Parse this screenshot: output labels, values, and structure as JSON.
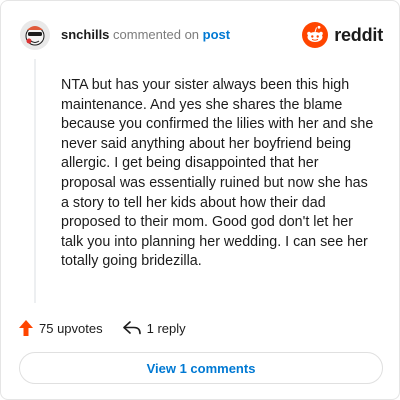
{
  "comment": {
    "username": "snchills",
    "action_text": "commented on",
    "post_link": "post",
    "body": "NTA but has your sister always been this high maintenance. And yes she shares the blame because you confirmed the lilies with her and she never said anything about her boyfriend being allergic. I get being disappointed that her proposal was essentially ruined but now she has a story to tell her kids about how their dad proposed to their mom. Good god don't let her talk you into planning her wedding. I can see her totally going bridezilla."
  },
  "brand": {
    "wordmark": "reddit",
    "accent": "#ff4500"
  },
  "footer": {
    "upvotes_label": "75 upvotes",
    "reply_label": "1 reply",
    "upvote_icon": "upvote-arrow-icon",
    "reply_icon": "reply-arrow-icon",
    "upvote_color": "#ff4500"
  },
  "view_button": {
    "label": "View 1 comments",
    "color": "#0079d3"
  }
}
